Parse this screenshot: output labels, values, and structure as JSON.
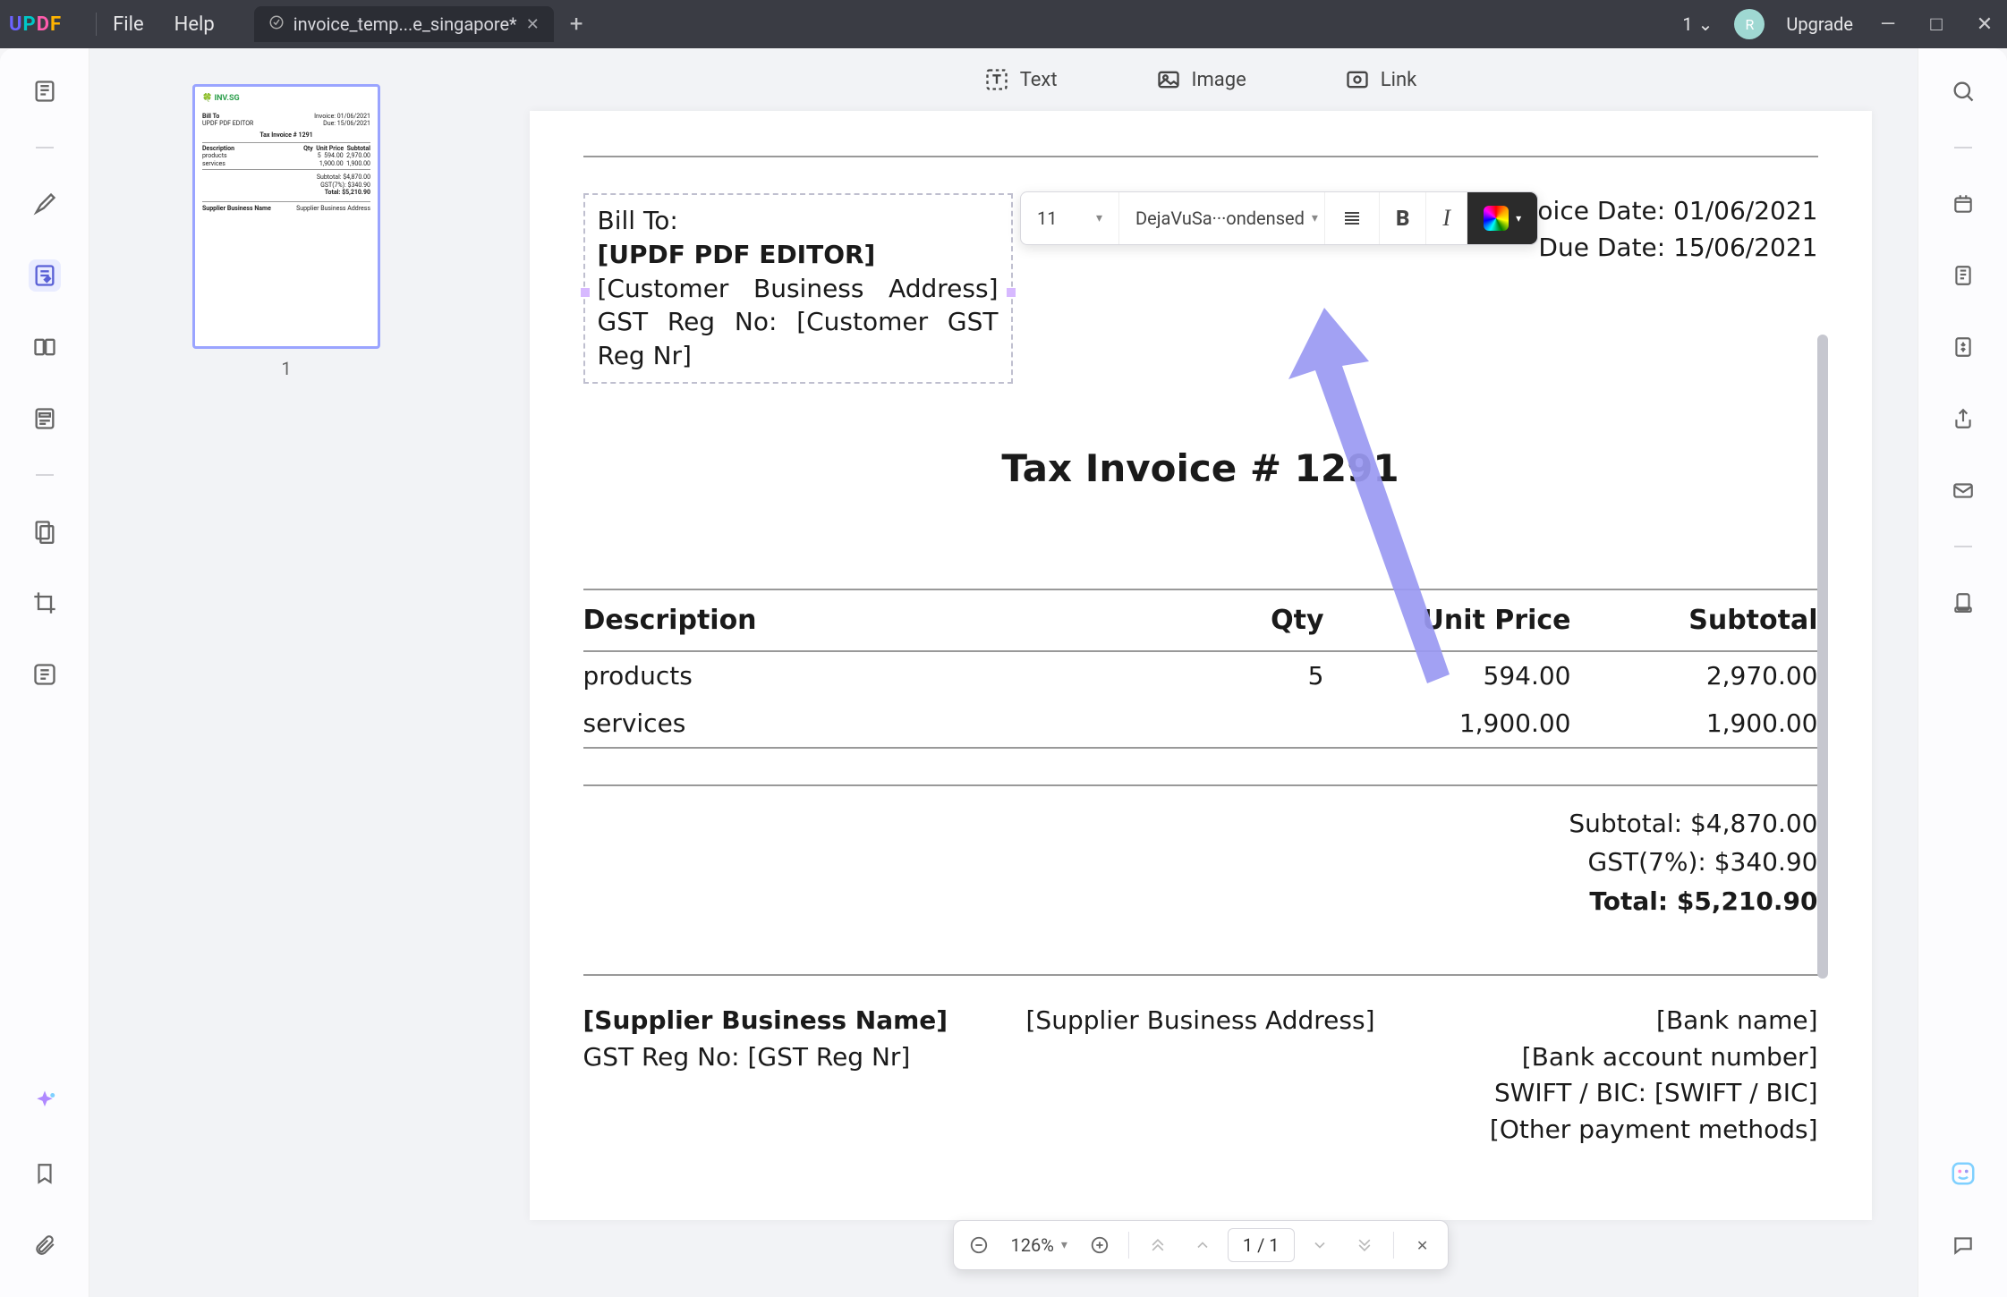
{
  "app": {
    "logo": "UPDF"
  },
  "menus": {
    "file": "File",
    "help": "Help"
  },
  "tab": {
    "title": "invoice_temp...e_singapore*"
  },
  "titlebar": {
    "count": "1",
    "upgrade": "Upgrade",
    "avatar_initial": "R"
  },
  "tools": {
    "text": "Text",
    "image": "Image",
    "link": "Link"
  },
  "float_toolbar": {
    "font_size": "11",
    "font_name": "DejaVuSa···ondensed"
  },
  "thumbnails": {
    "page1": "1"
  },
  "invoice": {
    "bill_to_label": "Bill To:",
    "bill_to_name": "[UPDF PDF EDITOR]",
    "bill_to_addr": "[Customer Business Address] GST Reg No: [Customer GST Reg Nr]",
    "invoice_date_label": "Invoice Date: 01/06/2021",
    "due_date_label": "Due Date: 15/06/2021",
    "title": "Tax Invoice # 1291",
    "cols": {
      "desc": "Description",
      "qty": "Qty",
      "unit": "Unit Price",
      "sub": "Subtotal"
    },
    "rows": [
      {
        "desc": "products",
        "qty": "5",
        "unit": "594.00",
        "sub": "2,970.00"
      },
      {
        "desc": "services",
        "qty": "",
        "unit": "1,900.00",
        "sub": "1,900.00"
      }
    ],
    "subtotal": "Subtotal: $4,870.00",
    "gst": "GST(7%): $340.90",
    "total": "Total: $5,210.90",
    "supplier_name": "[Supplier Business Name]",
    "supplier_gst": "GST Reg No: [GST Reg Nr]",
    "supplier_addr": "[Supplier Business Address]",
    "bank_name": "[Bank name]",
    "bank_acct": "[Bank account number]",
    "swift": "SWIFT / BIC: [SWIFT / BIC]",
    "other_pay": "[Other payment methods]"
  },
  "bottombar": {
    "zoom": "126%",
    "page": "1 / 1"
  }
}
